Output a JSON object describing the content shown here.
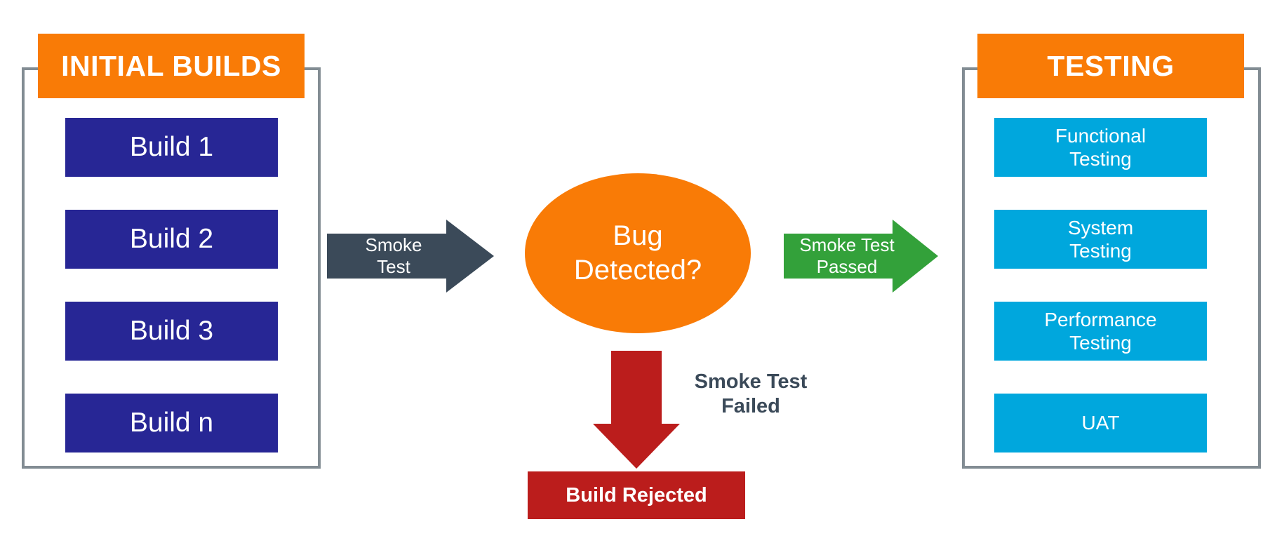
{
  "diagram": {
    "title_left": "INITIAL BUILDS",
    "title_right": "TESTING",
    "colors": {
      "orange": "#F97B06",
      "navy": "#272695",
      "cyan": "#00A7DD",
      "slate": "#3B4A59",
      "green": "#33A13A",
      "red": "#BB1D1C",
      "bracket_gray": "#828C93",
      "background": "#FFFFFF"
    }
  },
  "left_panel": {
    "header": "INITIAL BUILDS",
    "items": [
      {
        "label": "Build 1"
      },
      {
        "label": "Build 2"
      },
      {
        "label": "Build 3"
      },
      {
        "label": "Build n"
      }
    ]
  },
  "right_panel": {
    "header": "TESTING",
    "items": [
      {
        "label": "Functional\nTesting"
      },
      {
        "label": "System\nTesting"
      },
      {
        "label": "Performance\nTesting"
      },
      {
        "label": "UAT"
      }
    ]
  },
  "decision": {
    "label": "Bug\nDetected?"
  },
  "arrows": {
    "smoke_test": {
      "label": "Smoke\nTest",
      "color": "#3B4A59",
      "direction": "right"
    },
    "smoke_test_passed": {
      "label": "Smoke Test\nPassed",
      "color": "#33A13A",
      "direction": "right"
    },
    "smoke_test_failed": {
      "label": "Smoke Test\nFailed",
      "color": "#BB1D1C",
      "direction": "down"
    }
  },
  "outcome": {
    "build_rejected": "Build Rejected"
  }
}
